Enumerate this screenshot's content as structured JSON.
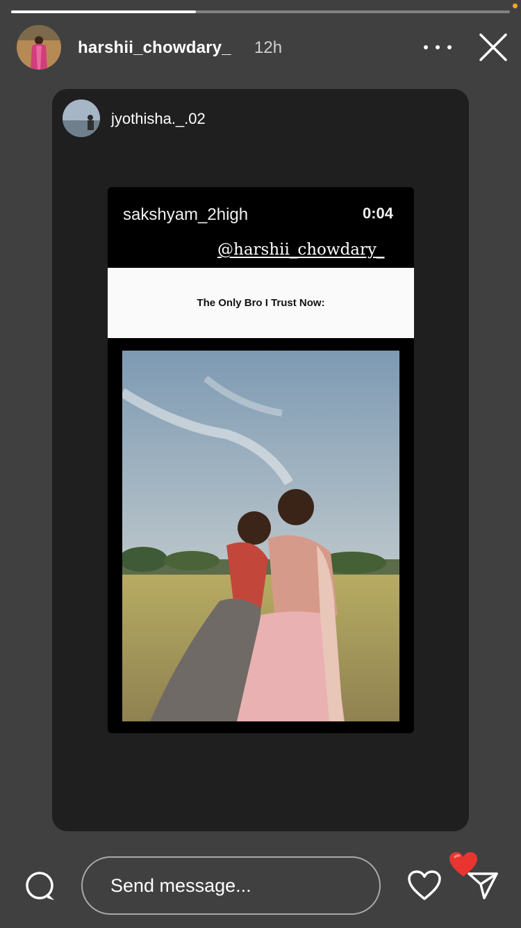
{
  "story": {
    "progress": 0.37,
    "username": "harshii_chowdary_",
    "time_ago": "12h"
  },
  "shared_post": {
    "author": "jyothisha._.02",
    "repost": {
      "username": "sakshyam_2high",
      "timestamp": "0:04",
      "mention": "@harshii_chowdary_",
      "caption": "The Only Bro I Trust Now:"
    }
  },
  "footer": {
    "message_placeholder": "Send message..."
  },
  "icons": {
    "more": "more-icon",
    "close": "close-icon",
    "comment": "comment-icon",
    "like": "heart-icon",
    "reaction": "heart-reaction-icon",
    "share": "paper-plane-icon"
  },
  "colors": {
    "background": "#404040",
    "card": "#1f1f1f",
    "reaction_heart": "#e8352f",
    "notification_dot": "#f5a623"
  }
}
